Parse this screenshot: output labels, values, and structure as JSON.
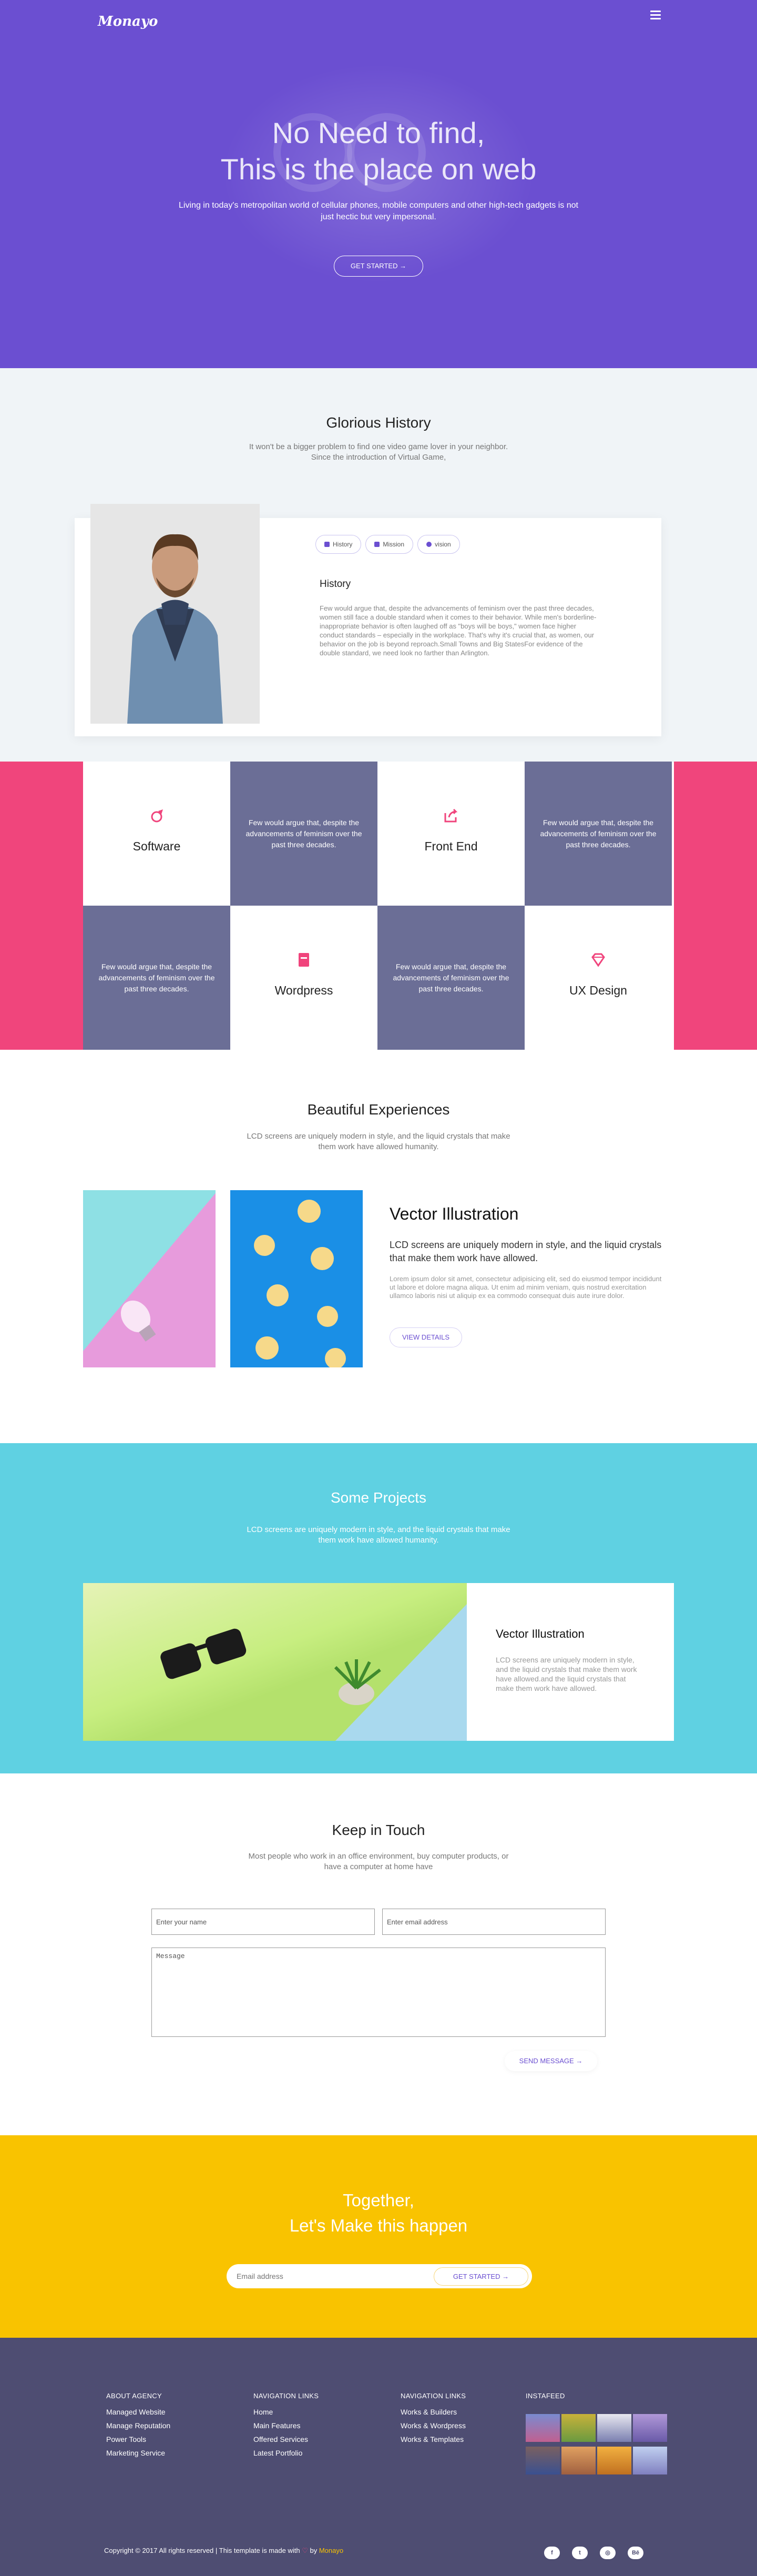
{
  "header": {
    "logo": "Monayo"
  },
  "hero": {
    "title_line1": "No Need to find,",
    "title_line2": "This is the place on web",
    "subtitle": "Living in today's metropolitan world of cellular phones, mobile computers and other high-tech gadgets is not just hectic but very impersonal.",
    "button": "GET STARTED",
    "arrow": "→"
  },
  "history": {
    "title": "Glorious History",
    "subtitle_line1": "It won't be a bigger problem to find one video game lover in your neighbor.",
    "subtitle_line2": "Since the introduction of Virtual Game,",
    "tabs": [
      {
        "label": "History"
      },
      {
        "label": "Mission"
      },
      {
        "label": "vision"
      }
    ],
    "heading": "History",
    "body": "Few would argue that, despite the advancements of feminism over the past three decades, women still face a double standard when it comes to their behavior. While men's borderline-inappropriate behavior is often laughed off as \"boys will be boys,\" women face higher conduct standards – especially in the workplace. That's why it's crucial that, as women, our behavior on the job is beyond reproach.Small Towns and Big StatesFor evidence of the double standard, we need look no farther than Arlington."
  },
  "services": {
    "blurb": "Few would argue that, despite the advancements of feminism over the past three decades.",
    "items": [
      {
        "label": "Software",
        "icon": "rocket-icon"
      },
      {
        "label": "Front End",
        "icon": "share-icon"
      },
      {
        "label": "Wordpress",
        "icon": "book-icon"
      },
      {
        "label": "UX Design",
        "icon": "diamond-icon"
      }
    ]
  },
  "experience": {
    "title": "Beautiful Experiences",
    "subtitle_line1": "LCD screens are uniquely modern in style, and the liquid crystals that make",
    "subtitle_line2": "them work have allowed humanity.",
    "heading": "Vector Illustration",
    "lead": "LCD screens are uniquely modern in style, and the liquid crystals that make them work have allowed.",
    "body": "Lorem ipsum dolor sit amet, consectetur adipisicing elit, sed do eiusmod tempor incididunt ut labore et dolore magna aliqua. Ut enim ad minim veniam, quis nostrud exercitation ullamco laboris nisi ut aliquip ex ea commodo consequat duis aute irure dolor.",
    "button": "VIEW DETAILS"
  },
  "projects": {
    "title": "Some Projects",
    "subtitle_line1": "LCD screens are uniquely modern in style, and the liquid crystals that make",
    "subtitle_line2": "them work have allowed humanity.",
    "card_heading": "Vector Illustration",
    "card_body": "LCD screens are uniquely modern in style, and the liquid crystals that make them work have allowed.and the liquid crystals that make them work have allowed."
  },
  "contact": {
    "title": "Keep in Touch",
    "subtitle_line1": "Most people who work in an office environment, buy computer products, or",
    "subtitle_line2": "have a computer at home have",
    "name_placeholder": "Enter your name",
    "email_placeholder": "Enter email address",
    "message_placeholder": "Message",
    "button": "SEND MESSAGE"
  },
  "cta": {
    "line1": "Together,",
    "line2": "Let's Make this happen",
    "email_placeholder": "Email address",
    "button": "GET STARTED"
  },
  "footer": {
    "col1": {
      "heading": "ABOUT AGENCY",
      "links": [
        "Managed Website",
        "Manage Reputation",
        "Power Tools",
        "Marketing Service"
      ]
    },
    "col2": {
      "heading": "NAVIGATION LINKS",
      "links": [
        "Home",
        "Main Features",
        "Offered Services",
        "Latest Portfolio"
      ]
    },
    "col3": {
      "heading": "NAVIGATION LINKS",
      "links": [
        "Works & Builders",
        "Works & Wordpress",
        "Works & Templates"
      ]
    },
    "col4": {
      "heading": "INSTAFEED"
    },
    "copyright_prefix": "Copyright © 2017 All rights reserved | This template is made with",
    "heart": "♡",
    "by": "by",
    "brand": "Monayo",
    "social": [
      {
        "icon": "facebook-icon",
        "glyph": "f"
      },
      {
        "icon": "twitter-icon",
        "glyph": "t"
      },
      {
        "icon": "instagram-icon",
        "glyph": "◎"
      },
      {
        "icon": "behance-icon",
        "glyph": "Bē"
      }
    ]
  },
  "colors": {
    "purple": "#6b4fd1",
    "pink": "#f0457c",
    "slate": "#6b6e96",
    "cyan": "#5fd1e2",
    "yellow": "#f9c300",
    "footer": "#4e4d72"
  }
}
